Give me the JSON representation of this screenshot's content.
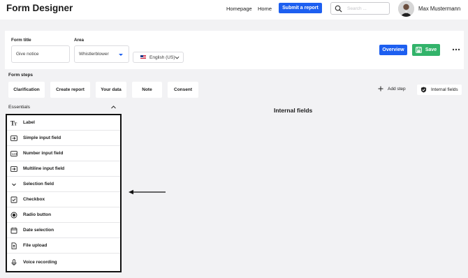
{
  "app": {
    "title": "Form Designer"
  },
  "nav": {
    "links": [
      "Homepage",
      "Home"
    ],
    "submit_label": "Submit a report"
  },
  "search": {
    "placeholder": "Search ..."
  },
  "user": {
    "name": "Max Mustermann"
  },
  "settings": {
    "title_label": "Form title",
    "title_value": "Give notice",
    "area_label": "Area",
    "area_value": "Whistlerblower",
    "language_value": "English (US)",
    "overview_label": "Overview",
    "save_label": "Save"
  },
  "steps": {
    "label": "Form steps",
    "items": [
      "Clarification",
      "Create report",
      "Your data",
      "Note",
      "Consent"
    ],
    "add_label": "Add step",
    "internal_label": "Internal fields"
  },
  "essentials": {
    "label": "Essentials",
    "items": [
      {
        "label": "Label",
        "icon": "text-icon"
      },
      {
        "label": "Simple input field",
        "icon": "input-icon"
      },
      {
        "label": "Number input field",
        "icon": "number-icon"
      },
      {
        "label": "Multiline input field",
        "icon": "multiline-icon"
      },
      {
        "label": "Selection field",
        "icon": "chevron-down-icon"
      },
      {
        "label": "Checkbox",
        "icon": "checkbox-icon"
      },
      {
        "label": "Radio button",
        "icon": "radio-icon"
      },
      {
        "label": "Date selection",
        "icon": "calendar-icon"
      },
      {
        "label": "File upload",
        "icon": "file-upload-icon"
      },
      {
        "label": "Voice recording",
        "icon": "microphone-icon"
      }
    ]
  },
  "main": {
    "heading": "Internal fields"
  },
  "colors": {
    "primary": "#1d5ff0",
    "success": "#32b36a",
    "background": "#f2f2f4"
  }
}
